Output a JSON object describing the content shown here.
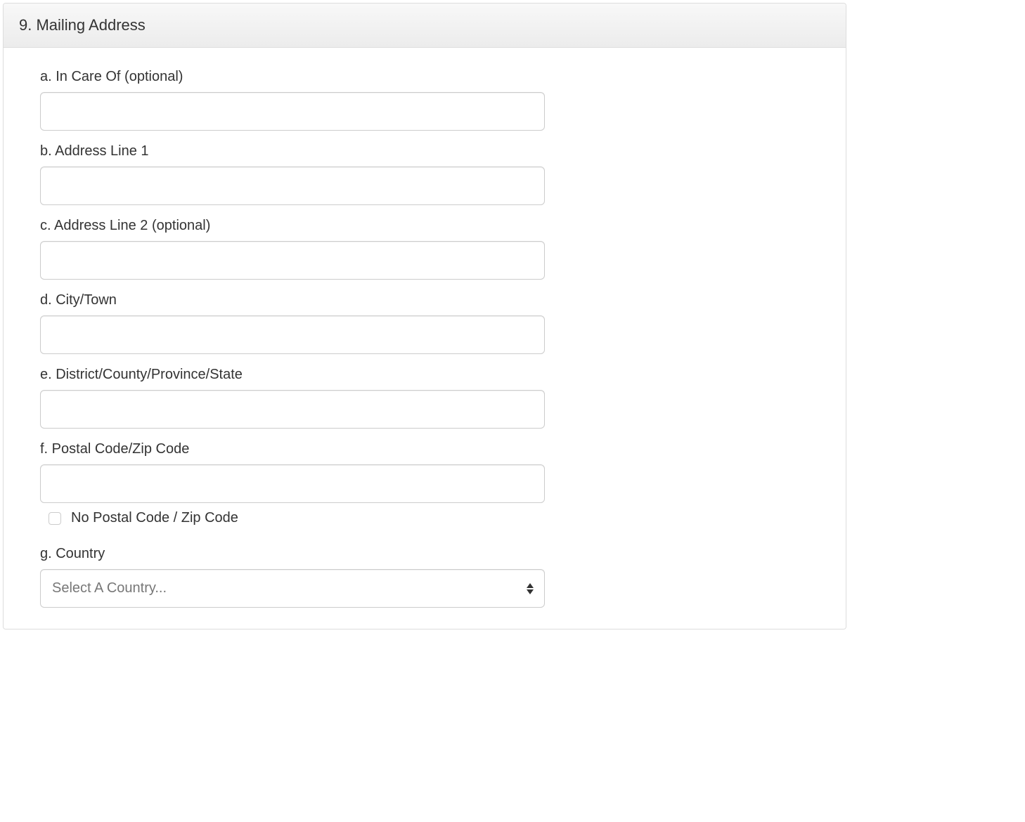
{
  "section": {
    "title": "9. Mailing Address"
  },
  "fields": {
    "in_care_of": {
      "label": "a. In Care Of (optional)",
      "value": ""
    },
    "address_line_1": {
      "label": "b. Address Line 1",
      "value": ""
    },
    "address_line_2": {
      "label": "c. Address Line 2 (optional)",
      "value": ""
    },
    "city_town": {
      "label": "d. City/Town",
      "value": ""
    },
    "district_state": {
      "label": "e. District/County/Province/State",
      "value": ""
    },
    "postal_code": {
      "label": "f. Postal Code/Zip Code",
      "value": ""
    },
    "no_postal_code": {
      "label": "No Postal Code / Zip Code"
    },
    "country": {
      "label": "g. Country",
      "placeholder": "Select A Country..."
    }
  }
}
